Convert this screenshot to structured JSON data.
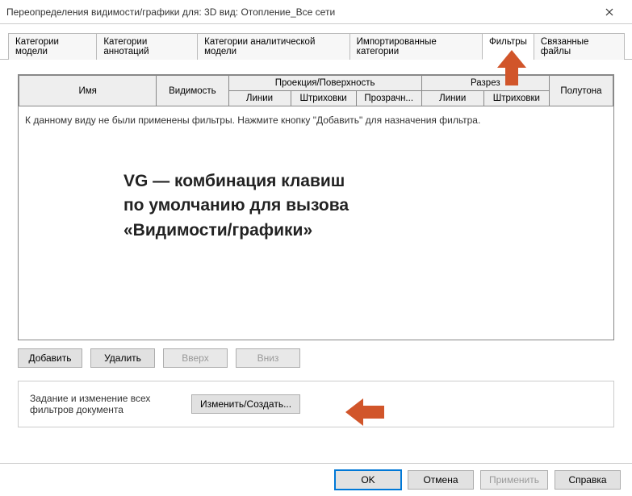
{
  "window": {
    "title": "Переопределения видимости/графики для: 3D вид: Отопление_Все сети"
  },
  "tabs": {
    "model": "Категории модели",
    "annot": "Категории аннотаций",
    "analytical": "Категории аналитической модели",
    "imported": "Импортированные категории",
    "filters": "Фильтры",
    "links": "Связанные файлы"
  },
  "grid": {
    "headers": {
      "name": "Имя",
      "visibility": "Видимость",
      "projection_group": "Проекция/Поверхность",
      "cut_group": "Разрез",
      "lines": "Линии",
      "patterns": "Штриховки",
      "transparency": "Прозрачн...",
      "cut_lines": "Линии",
      "cut_patterns": "Штриховки",
      "halftone": "Полутона"
    },
    "empty_message": "К данному виду не были применены фильтры. Нажмите кнопку \"Добавить\" для назначения фильтра."
  },
  "overlay": {
    "line1": "VG — комбинация клавиш",
    "line2": "по умолчанию для вызова",
    "line3": "«Видимости/графики»"
  },
  "buttons": {
    "add": "Добавить",
    "remove": "Удалить",
    "up": "Вверх",
    "down": "Вниз",
    "edit_create": "Изменить/Создать...",
    "ok": "OK",
    "cancel": "Отмена",
    "apply": "Применить",
    "help": "Справка"
  },
  "lower": {
    "label": "Задание и изменение всех фильтров документа"
  },
  "annotation_color": "#d1552a"
}
